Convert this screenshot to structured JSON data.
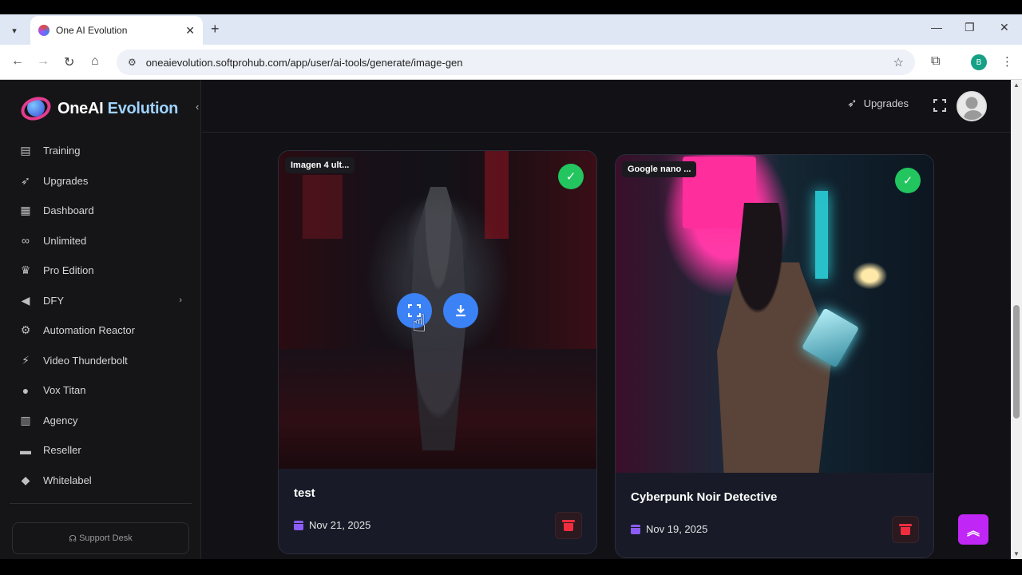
{
  "browser": {
    "tab_title": "One AI Evolution",
    "url": "oneaievolution.softprohub.com/app/user/ai-tools/generate/image-gen",
    "profile_initial": "B"
  },
  "sidebar": {
    "logo": {
      "prefix": "OneAI ",
      "suffix": "Evolution"
    },
    "items": [
      {
        "label": "Training",
        "icon": "training-icon"
      },
      {
        "label": "Upgrades",
        "icon": "rocket-icon"
      },
      {
        "label": "Dashboard",
        "icon": "dashboard-icon"
      },
      {
        "label": "Unlimited",
        "icon": "infinity-icon"
      },
      {
        "label": "Pro Edition",
        "icon": "crown-icon"
      },
      {
        "label": "DFY",
        "icon": "megaphone-icon"
      },
      {
        "label": "Automation Reactor",
        "icon": "gears-icon"
      },
      {
        "label": "Video Thunderbolt",
        "icon": "bolt-icon"
      },
      {
        "label": "Vox Titan",
        "icon": "microphone-icon"
      },
      {
        "label": "Agency",
        "icon": "building-icon"
      },
      {
        "label": "Reseller",
        "icon": "store-icon"
      },
      {
        "label": "Whitelabel",
        "icon": "tag-icon"
      }
    ],
    "support_label": "Support Desk"
  },
  "header": {
    "upgrades_label": "Upgrades"
  },
  "cards": [
    {
      "model": "Imagen 4 ult...",
      "title": "test",
      "date": "Nov 21, 2025"
    },
    {
      "model": "Google nano ...",
      "title": "Cyberpunk Noir Detective",
      "date": "Nov 19, 2025"
    }
  ],
  "colors": {
    "accent_green": "#22c55e",
    "accent_blue": "#3b82f6",
    "accent_purple": "#c026f5",
    "danger": "#ef2d3f"
  }
}
